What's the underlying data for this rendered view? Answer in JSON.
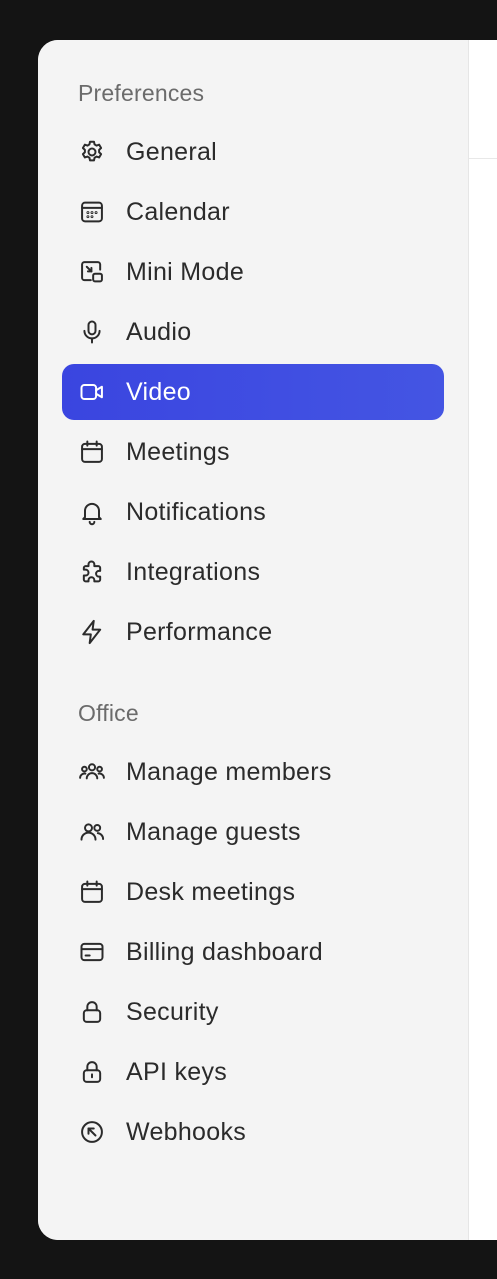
{
  "sidebar": {
    "sections": [
      {
        "label": "Preferences",
        "items": [
          {
            "label": "General",
            "icon": "gear-icon"
          },
          {
            "label": "Calendar",
            "icon": "calendar-grid-icon"
          },
          {
            "label": "Mini Mode",
            "icon": "mini-mode-icon"
          },
          {
            "label": "Audio",
            "icon": "microphone-icon"
          },
          {
            "label": "Video",
            "icon": "video-camera-icon",
            "active": true
          },
          {
            "label": "Meetings",
            "icon": "calendar-icon"
          },
          {
            "label": "Notifications",
            "icon": "bell-icon"
          },
          {
            "label": "Integrations",
            "icon": "puzzle-icon"
          },
          {
            "label": "Performance",
            "icon": "lightning-icon"
          }
        ]
      },
      {
        "label": "Office",
        "items": [
          {
            "label": "Manage members",
            "icon": "users-group-icon"
          },
          {
            "label": "Manage guests",
            "icon": "users-icon"
          },
          {
            "label": "Desk meetings",
            "icon": "calendar-icon"
          },
          {
            "label": "Billing dashboard",
            "icon": "credit-card-icon"
          },
          {
            "label": "Security",
            "icon": "lock-icon"
          },
          {
            "label": "API keys",
            "icon": "lock-keyhole-icon"
          },
          {
            "label": "Webhooks",
            "icon": "arrow-up-left-circle-icon"
          }
        ]
      }
    ]
  },
  "colors": {
    "active_bg": "#3a45e0",
    "sidebar_bg": "#f4f4f4",
    "outer_bg": "#141414"
  }
}
